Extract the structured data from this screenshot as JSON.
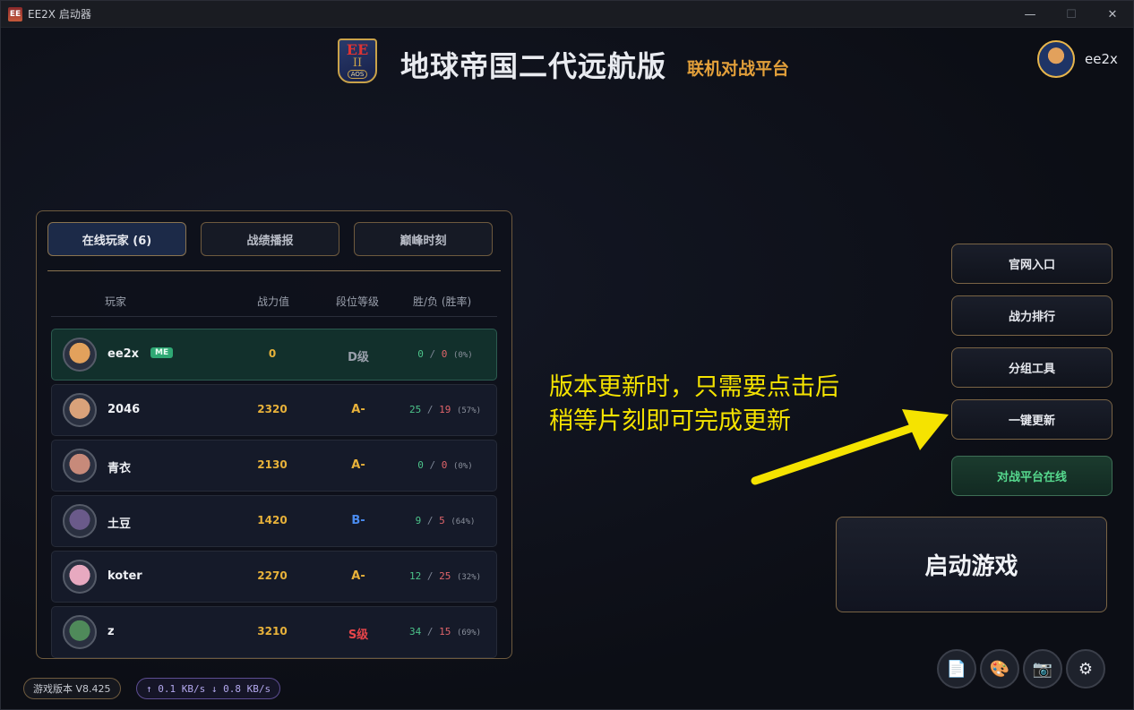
{
  "window": {
    "title": "EE2X 启动器",
    "app_icon": "EE"
  },
  "header": {
    "logo": {
      "line1": "EE",
      "line2": "II",
      "line3": "AOS"
    },
    "title": "地球帝国二代远航版",
    "subtitle": "联机对战平台",
    "user": {
      "name": "ee2x"
    }
  },
  "tabs": [
    {
      "label": "在线玩家 (6)",
      "active": true
    },
    {
      "label": "战绩播报",
      "active": false
    },
    {
      "label": "巅峰时刻",
      "active": false
    }
  ],
  "table": {
    "headers": {
      "player": "玩家",
      "power": "战力值",
      "rank": "段位等级",
      "record": "胜/负 (胜率)"
    },
    "rows": [
      {
        "name": "ee2x",
        "badge": "ME",
        "power": "0",
        "rank": "D级",
        "rank_color": "#9aa0ac",
        "wins": "0",
        "losses": "0",
        "pct": "(0%)",
        "avatar_color": "#e2a15c",
        "me": true
      },
      {
        "name": "2046",
        "power": "2320",
        "rank": "A-",
        "rank_color": "#e8b23a",
        "wins": "25",
        "losses": "19",
        "pct": "(57%)",
        "avatar_color": "#d9a27a"
      },
      {
        "name": "青衣",
        "power": "2130",
        "rank": "A-",
        "rank_color": "#e8b23a",
        "wins": "0",
        "losses": "0",
        "pct": "(0%)",
        "avatar_color": "#c78a7a"
      },
      {
        "name": "土豆",
        "power": "1420",
        "rank": "B-",
        "rank_color": "#4a8cf0",
        "wins": "9",
        "losses": "5",
        "pct": "(64%)",
        "avatar_color": "#6a5a8a"
      },
      {
        "name": "koter",
        "power": "2270",
        "rank": "A-",
        "rank_color": "#e8b23a",
        "wins": "12",
        "losses": "25",
        "pct": "(32%)",
        "avatar_color": "#e7a9c0"
      },
      {
        "name": "z",
        "power": "3210",
        "rank": "S级",
        "rank_color": "#e8454a",
        "wins": "34",
        "losses": "15",
        "pct": "(69%)",
        "avatar_color": "#4f8a5a"
      }
    ]
  },
  "side_buttons": {
    "website": "官网入口",
    "ranking": "战力排行",
    "team_tool": "分组工具",
    "update": "一键更新",
    "platform_online": "对战平台在线"
  },
  "launch": {
    "label": "启动游戏"
  },
  "tools": [
    {
      "icon": "document-icon",
      "glyph": "📄"
    },
    {
      "icon": "palette-icon",
      "glyph": "🎨"
    },
    {
      "icon": "camera-icon",
      "glyph": "📷"
    },
    {
      "icon": "gear-icon",
      "glyph": "⚙"
    }
  ],
  "annotation": {
    "line1": "版本更新时，只需要点击后",
    "line2": "稍等片刻即可完成更新",
    "color": "#f5e300"
  },
  "footer": {
    "version": "游戏版本 V8.425",
    "speed": "↑ 0.1 KB/s ↓ 0.8 KB/s"
  }
}
